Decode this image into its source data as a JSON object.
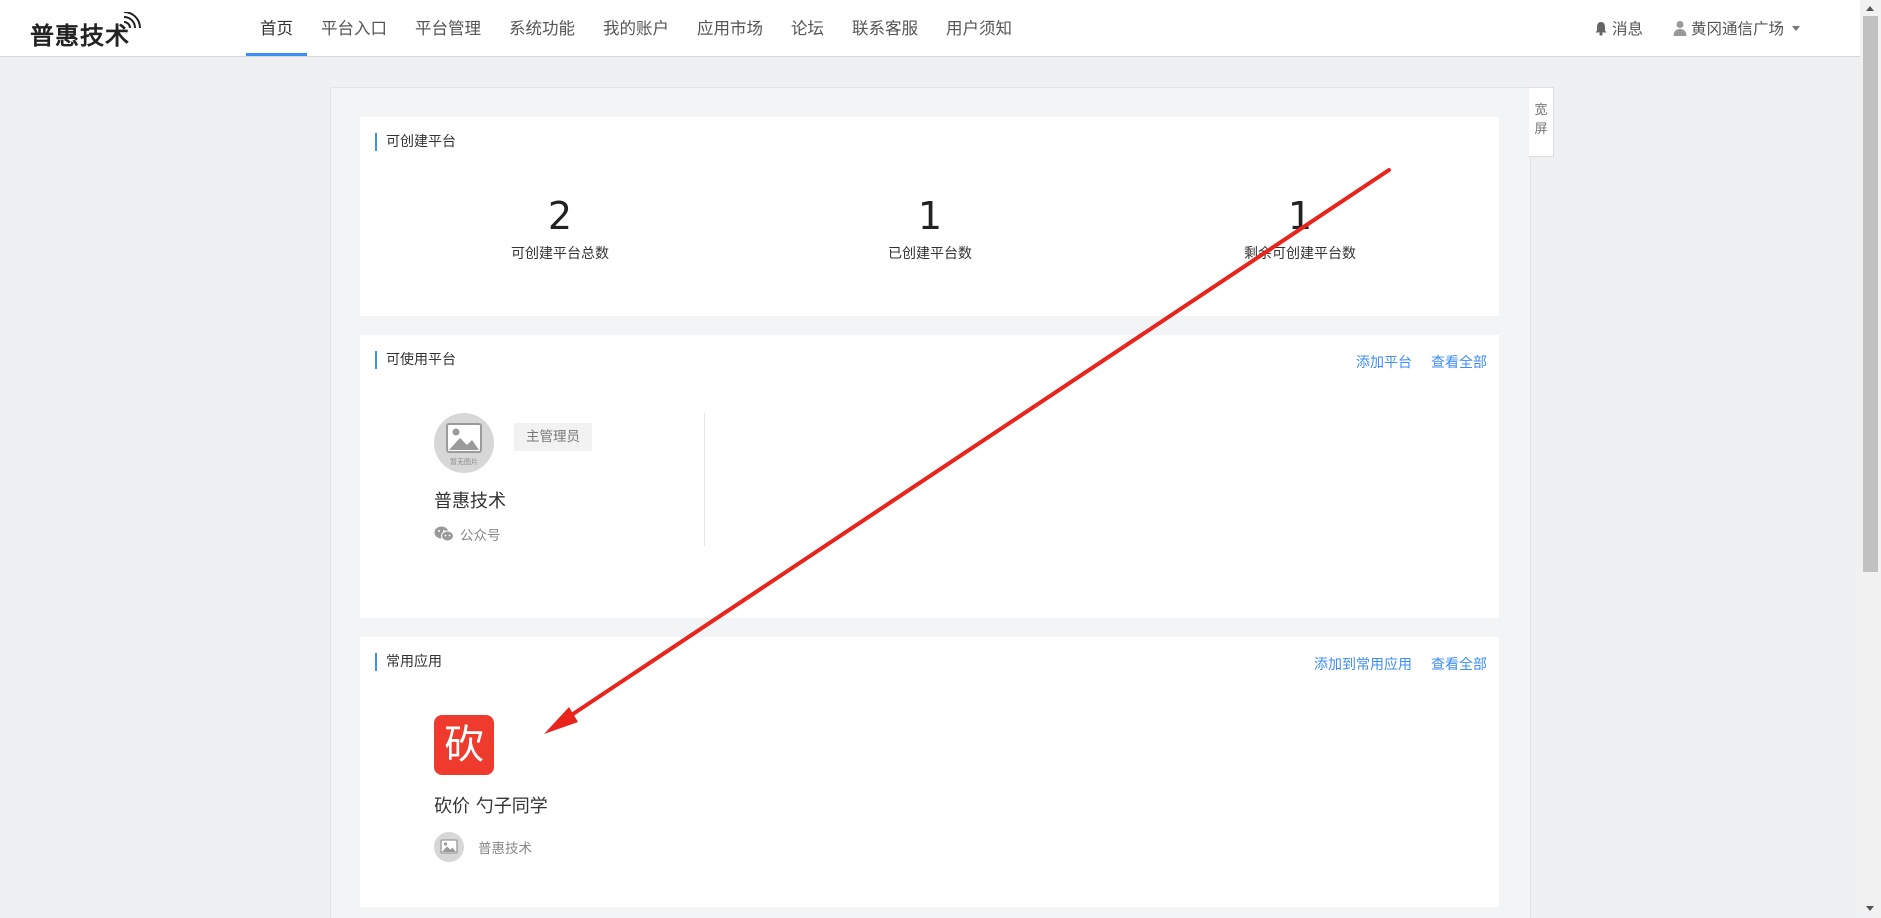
{
  "brand": {
    "name": "普惠技术"
  },
  "nav": {
    "items": [
      {
        "label": "首页",
        "active": true
      },
      {
        "label": "平台入口"
      },
      {
        "label": "平台管理"
      },
      {
        "label": "系统功能"
      },
      {
        "label": "我的账户"
      },
      {
        "label": "应用市场"
      },
      {
        "label": "论坛"
      },
      {
        "label": "联系客服"
      },
      {
        "label": "用户须知"
      }
    ]
  },
  "header_right": {
    "message_label": "消息",
    "user_name": "黄冈通信广场"
  },
  "side_toggle": {
    "label_line1": "宽",
    "label_line2": "屏"
  },
  "create_section": {
    "title": "可创建平台",
    "stats": [
      {
        "value": "2",
        "label": "可创建平台总数"
      },
      {
        "value": "1",
        "label": "已创建平台数"
      },
      {
        "value": "1",
        "label": "剩余可创建平台数"
      }
    ]
  },
  "usable_section": {
    "title": "可使用平台",
    "add_link": "添加平台",
    "view_all_link": "查看全部",
    "platforms": [
      {
        "name": "普惠技术",
        "role": "主管理员",
        "type": "公众号",
        "avatar_caption": "暂无图片"
      }
    ]
  },
  "apps_section": {
    "title": "常用应用",
    "add_link": "添加到常用应用",
    "view_all_link": "查看全部",
    "apps": [
      {
        "icon_glyph": "砍",
        "name": "砍价 勺子同学",
        "owner": "普惠技术"
      }
    ]
  },
  "colors": {
    "accent": "#3e8ef7",
    "app_icon_bg": "#ef3b2d",
    "annotation_arrow": "#e8241c",
    "page_bg": "#eff0f2"
  }
}
